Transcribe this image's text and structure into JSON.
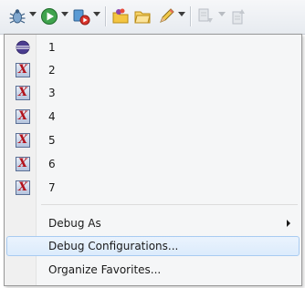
{
  "toolbar": {
    "buttons": [
      {
        "icon": "debug-bug-icon"
      },
      {
        "icon": "run-play-icon"
      },
      {
        "icon": "external-tools-icon"
      },
      {
        "icon": "open-folder-icon"
      },
      {
        "icon": "open-folder-alt-icon"
      },
      {
        "icon": "pencil-icon"
      },
      {
        "icon": "next-annotation-icon"
      },
      {
        "icon": "previous-annotation-icon"
      }
    ]
  },
  "menu": {
    "history_items": [
      {
        "label": "1",
        "icon": "eclipse-launch-icon"
      },
      {
        "label": "2",
        "icon": "x-launch-icon"
      },
      {
        "label": "3",
        "icon": "x-launch-icon"
      },
      {
        "label": "4",
        "icon": "x-launch-icon"
      },
      {
        "label": "5",
        "icon": "x-launch-icon"
      },
      {
        "label": "6",
        "icon": "x-launch-icon"
      },
      {
        "label": "7",
        "icon": "x-launch-icon"
      }
    ],
    "debug_as": "Debug As",
    "debug_configurations": "Debug Configurations...",
    "organize_favorites": "Organize Favorites..."
  },
  "colors": {
    "selection_bg": "#dcebfc",
    "selection_border": "#a8cbf1",
    "x_icon_letter": "#b3121b"
  }
}
